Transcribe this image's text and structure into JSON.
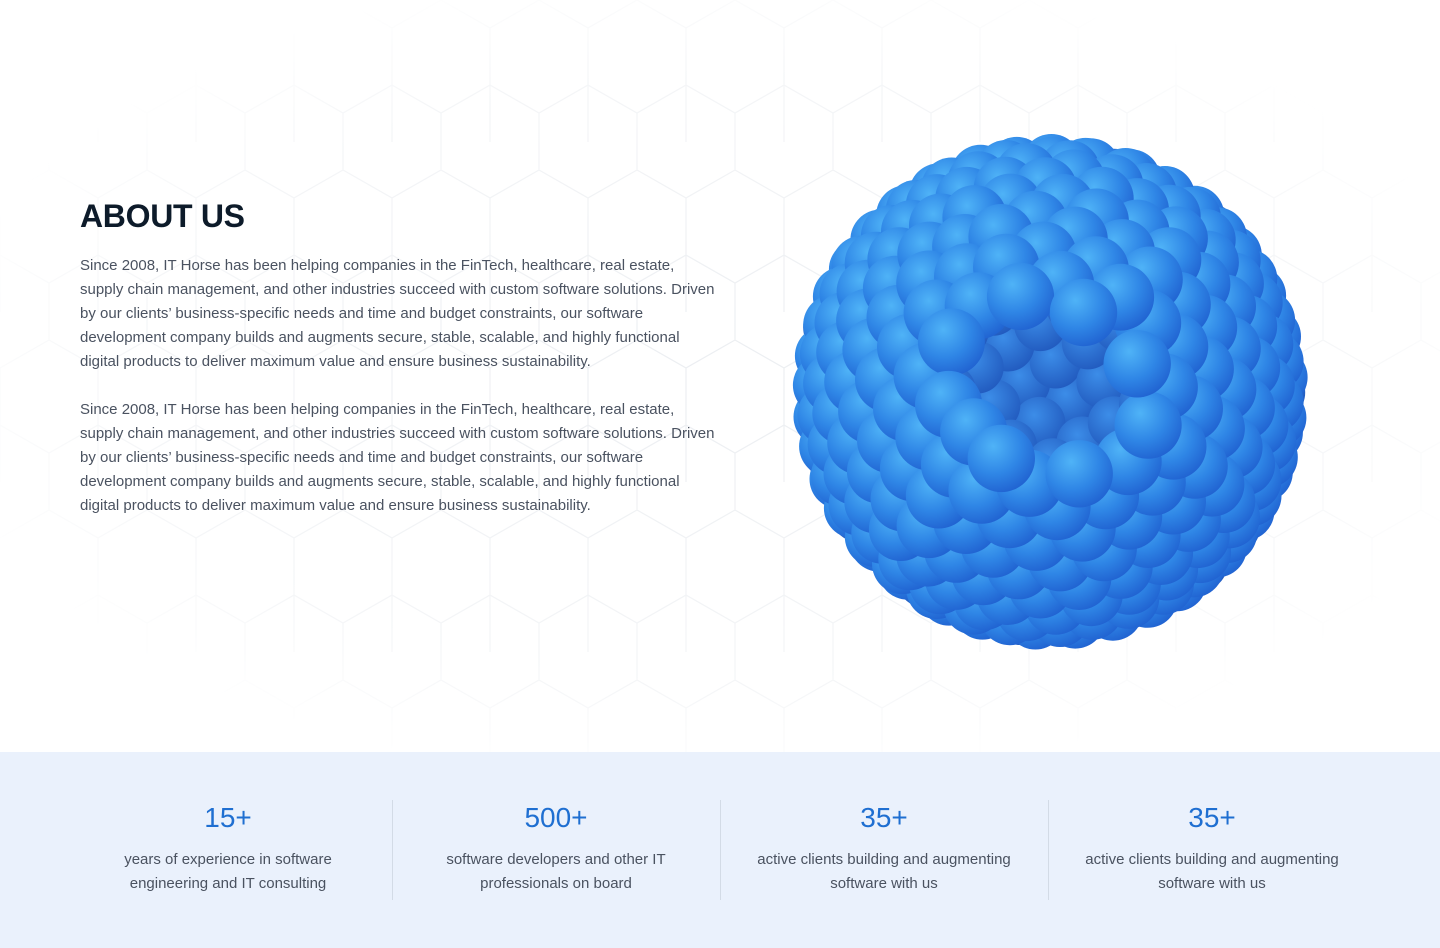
{
  "about": {
    "title": "ABOUT US",
    "paragraphs": [
      "Since 2008, IT Horse has been helping companies in the FinTech, healthcare, real estate, supply chain management, and other industries succeed with custom software solutions. Driven by our clients’ business-specific needs and time and budget constraints, our software development company builds and augments secure, stable, scalable, and highly functional digital products to deliver maximum value and ensure business sustainability.",
      "Since 2008, IT Horse has been helping companies in the FinTech, healthcare, real estate, supply chain management, and other industries succeed with custom software solutions. Driven by our clients’ business-specific needs and time and budget constraints, our software development company builds and augments secure, stable, scalable, and highly functional digital products to deliver maximum value and ensure business sustainability."
    ],
    "illustration": "blue-sphere-of-balls-illustration"
  },
  "stats": [
    {
      "value": "15+",
      "label": "years of experience in software engineering and IT consulting"
    },
    {
      "value": "500+",
      "label": "software developers and other IT professionals on board"
    },
    {
      "value": "35+",
      "label": "active clients building and augmenting software with us"
    },
    {
      "value": "35+",
      "label": "active clients building and augmenting software with us"
    }
  ],
  "colors": {
    "accent": "#1f6fd1",
    "title": "#0d1b2a",
    "stats_background": "#eaf1fc",
    "sphere_light": "#3aa0f2",
    "sphere_dark": "#2b66d8"
  }
}
